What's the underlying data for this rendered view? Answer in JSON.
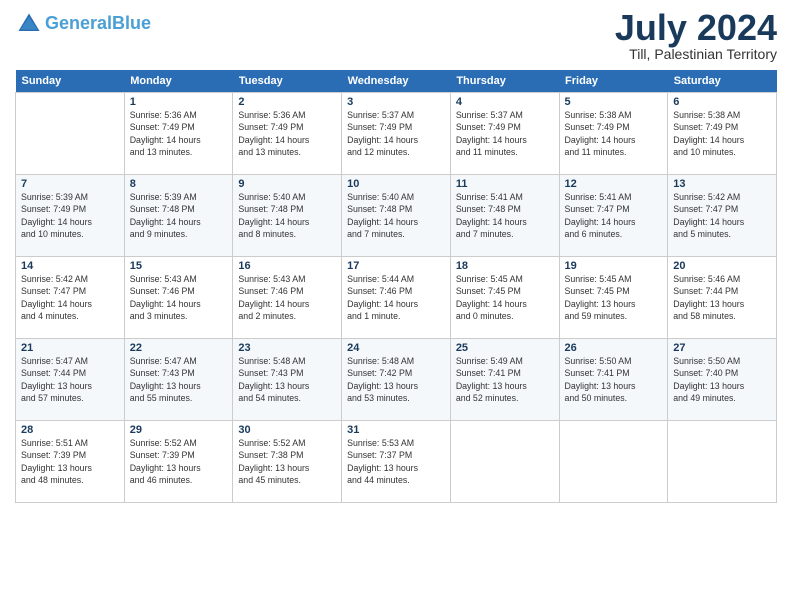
{
  "header": {
    "logo_line1": "General",
    "logo_line2": "Blue",
    "month_year": "July 2024",
    "location": "Till, Palestinian Territory"
  },
  "days_of_week": [
    "Sunday",
    "Monday",
    "Tuesday",
    "Wednesday",
    "Thursday",
    "Friday",
    "Saturday"
  ],
  "weeks": [
    [
      {
        "day": "",
        "info": ""
      },
      {
        "day": "1",
        "info": "Sunrise: 5:36 AM\nSunset: 7:49 PM\nDaylight: 14 hours\nand 13 minutes."
      },
      {
        "day": "2",
        "info": "Sunrise: 5:36 AM\nSunset: 7:49 PM\nDaylight: 14 hours\nand 13 minutes."
      },
      {
        "day": "3",
        "info": "Sunrise: 5:37 AM\nSunset: 7:49 PM\nDaylight: 14 hours\nand 12 minutes."
      },
      {
        "day": "4",
        "info": "Sunrise: 5:37 AM\nSunset: 7:49 PM\nDaylight: 14 hours\nand 11 minutes."
      },
      {
        "day": "5",
        "info": "Sunrise: 5:38 AM\nSunset: 7:49 PM\nDaylight: 14 hours\nand 11 minutes."
      },
      {
        "day": "6",
        "info": "Sunrise: 5:38 AM\nSunset: 7:49 PM\nDaylight: 14 hours\nand 10 minutes."
      }
    ],
    [
      {
        "day": "7",
        "info": "Sunrise: 5:39 AM\nSunset: 7:49 PM\nDaylight: 14 hours\nand 10 minutes."
      },
      {
        "day": "8",
        "info": "Sunrise: 5:39 AM\nSunset: 7:48 PM\nDaylight: 14 hours\nand 9 minutes."
      },
      {
        "day": "9",
        "info": "Sunrise: 5:40 AM\nSunset: 7:48 PM\nDaylight: 14 hours\nand 8 minutes."
      },
      {
        "day": "10",
        "info": "Sunrise: 5:40 AM\nSunset: 7:48 PM\nDaylight: 14 hours\nand 7 minutes."
      },
      {
        "day": "11",
        "info": "Sunrise: 5:41 AM\nSunset: 7:48 PM\nDaylight: 14 hours\nand 7 minutes."
      },
      {
        "day": "12",
        "info": "Sunrise: 5:41 AM\nSunset: 7:47 PM\nDaylight: 14 hours\nand 6 minutes."
      },
      {
        "day": "13",
        "info": "Sunrise: 5:42 AM\nSunset: 7:47 PM\nDaylight: 14 hours\nand 5 minutes."
      }
    ],
    [
      {
        "day": "14",
        "info": "Sunrise: 5:42 AM\nSunset: 7:47 PM\nDaylight: 14 hours\nand 4 minutes."
      },
      {
        "day": "15",
        "info": "Sunrise: 5:43 AM\nSunset: 7:46 PM\nDaylight: 14 hours\nand 3 minutes."
      },
      {
        "day": "16",
        "info": "Sunrise: 5:43 AM\nSunset: 7:46 PM\nDaylight: 14 hours\nand 2 minutes."
      },
      {
        "day": "17",
        "info": "Sunrise: 5:44 AM\nSunset: 7:46 PM\nDaylight: 14 hours\nand 1 minute."
      },
      {
        "day": "18",
        "info": "Sunrise: 5:45 AM\nSunset: 7:45 PM\nDaylight: 14 hours\nand 0 minutes."
      },
      {
        "day": "19",
        "info": "Sunrise: 5:45 AM\nSunset: 7:45 PM\nDaylight: 13 hours\nand 59 minutes."
      },
      {
        "day": "20",
        "info": "Sunrise: 5:46 AM\nSunset: 7:44 PM\nDaylight: 13 hours\nand 58 minutes."
      }
    ],
    [
      {
        "day": "21",
        "info": "Sunrise: 5:47 AM\nSunset: 7:44 PM\nDaylight: 13 hours\nand 57 minutes."
      },
      {
        "day": "22",
        "info": "Sunrise: 5:47 AM\nSunset: 7:43 PM\nDaylight: 13 hours\nand 55 minutes."
      },
      {
        "day": "23",
        "info": "Sunrise: 5:48 AM\nSunset: 7:43 PM\nDaylight: 13 hours\nand 54 minutes."
      },
      {
        "day": "24",
        "info": "Sunrise: 5:48 AM\nSunset: 7:42 PM\nDaylight: 13 hours\nand 53 minutes."
      },
      {
        "day": "25",
        "info": "Sunrise: 5:49 AM\nSunset: 7:41 PM\nDaylight: 13 hours\nand 52 minutes."
      },
      {
        "day": "26",
        "info": "Sunrise: 5:50 AM\nSunset: 7:41 PM\nDaylight: 13 hours\nand 50 minutes."
      },
      {
        "day": "27",
        "info": "Sunrise: 5:50 AM\nSunset: 7:40 PM\nDaylight: 13 hours\nand 49 minutes."
      }
    ],
    [
      {
        "day": "28",
        "info": "Sunrise: 5:51 AM\nSunset: 7:39 PM\nDaylight: 13 hours\nand 48 minutes."
      },
      {
        "day": "29",
        "info": "Sunrise: 5:52 AM\nSunset: 7:39 PM\nDaylight: 13 hours\nand 46 minutes."
      },
      {
        "day": "30",
        "info": "Sunrise: 5:52 AM\nSunset: 7:38 PM\nDaylight: 13 hours\nand 45 minutes."
      },
      {
        "day": "31",
        "info": "Sunrise: 5:53 AM\nSunset: 7:37 PM\nDaylight: 13 hours\nand 44 minutes."
      },
      {
        "day": "",
        "info": ""
      },
      {
        "day": "",
        "info": ""
      },
      {
        "day": "",
        "info": ""
      }
    ]
  ]
}
